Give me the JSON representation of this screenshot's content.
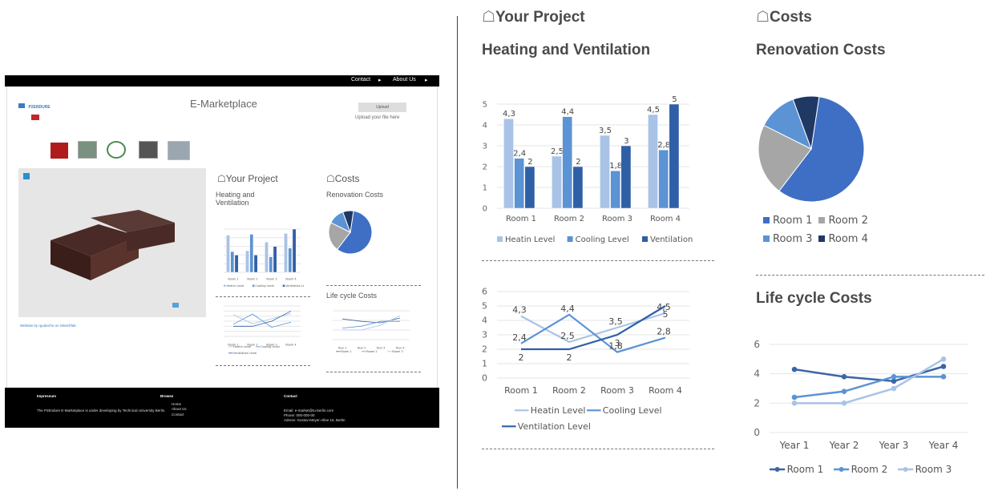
{
  "site": {
    "nav": {
      "contact": "Contact",
      "about": "About Us"
    },
    "title": "E-Marketplace",
    "upload_button": "Upload",
    "upload_hint": "Upload your file here",
    "logo_text": "P2ENDURE",
    "model_credit": "Website by rgudeche on Sketchfab",
    "project_heading": "Your Project",
    "heating_heading": "Heating and Ventilation",
    "costs_heading": "Costs",
    "renovation_heading": "Renovation Costs",
    "lifecycle_heading": "Life cycle Costs",
    "footer": {
      "impressum": "Impressum",
      "impressum_text": "The P2Endure E-Marketplace is under developing by Technical University Berlin.",
      "browse": "Browse",
      "browse_items": [
        "Home",
        "About Us",
        "Contact"
      ],
      "contact": "Contact",
      "contact_lines": [
        "Email: e-market@tu-berlin.com",
        "Phone: 000-000-00",
        "Adress: Gustav-Meyer-Allee 16, Berlin"
      ]
    }
  },
  "panel": {
    "project_title": "Your Project",
    "heating_title": "Heating and Ventilation",
    "costs_title": "Costs",
    "renovation_title": "Renovation Costs",
    "lifecycle_title": "Life cycle Costs"
  },
  "colors": {
    "heating": "#a9c3e6",
    "cooling": "#5b93d4",
    "ventilation": "#2f5fa6",
    "room1": "#3f6fc4",
    "room2": "#a6a6a6",
    "room3": "#5b93d4",
    "room4": "#1f3864"
  },
  "chart_data": [
    {
      "type": "bar",
      "categories": [
        "Room 1",
        "Room 2",
        "Room 3",
        "Room 4"
      ],
      "series": [
        {
          "name": "Heatin Level",
          "values": [
            4.3,
            2.5,
            3.5,
            4.5
          ]
        },
        {
          "name": "Cooling Level",
          "values": [
            2.4,
            4.4,
            1.8,
            2.8
          ]
        },
        {
          "name": "Ventilation Level",
          "values": [
            2,
            2,
            3,
            5
          ]
        }
      ],
      "ylim": [
        0,
        5
      ],
      "yticks": [
        "0",
        "1",
        "2",
        "3",
        "4",
        "5"
      ],
      "data_labels": [
        [
          "4,3",
          "2,5",
          "3,5",
          "4,5"
        ],
        [
          "2,4",
          "4,4",
          "1,8",
          "2,8"
        ],
        [
          "2",
          "2",
          "3",
          "5"
        ]
      ],
      "legend": "bottom"
    },
    {
      "type": "line",
      "categories": [
        "Room 1",
        "Room 2",
        "Room 3",
        "Room 4"
      ],
      "series": [
        {
          "name": "Heatin Level",
          "values": [
            4.3,
            2.5,
            3.5,
            4.5
          ]
        },
        {
          "name": "Cooling Level",
          "values": [
            2.4,
            4.4,
            1.8,
            2.8
          ]
        },
        {
          "name": "Ventilation Level",
          "values": [
            2,
            2,
            3,
            5
          ]
        }
      ],
      "ylim": [
        0,
        6
      ],
      "yticks": [
        "0",
        "1",
        "2",
        "3",
        "4",
        "5",
        "6"
      ],
      "data_labels": [
        [
          "4,3",
          "2,5",
          "3,5",
          "4,5"
        ],
        [
          "2,4",
          "4,4",
          "1,8",
          "2,8"
        ],
        [
          "2",
          "2",
          "3",
          "5"
        ]
      ],
      "legend": "bottom"
    },
    {
      "type": "pie",
      "categories": [
        "Room 1",
        "Room 2",
        "Room 3",
        "Room 4"
      ],
      "values": [
        58,
        22,
        12,
        8
      ],
      "legend": "bottom"
    },
    {
      "type": "line",
      "categories": [
        "Year 1",
        "Year 2",
        "Year 3",
        "Year 4"
      ],
      "series": [
        {
          "name": "Room 1",
          "values": [
            4.3,
            3.8,
            3.5,
            4.5
          ]
        },
        {
          "name": "Room 2",
          "values": [
            2.4,
            2.8,
            3.8,
            3.8
          ]
        },
        {
          "name": "Room 3",
          "values": [
            2,
            2,
            3,
            5
          ]
        }
      ],
      "ylim": [
        0,
        6
      ],
      "yticks": [
        "0",
        "2",
        "4",
        "6"
      ],
      "legend": "bottom"
    }
  ]
}
